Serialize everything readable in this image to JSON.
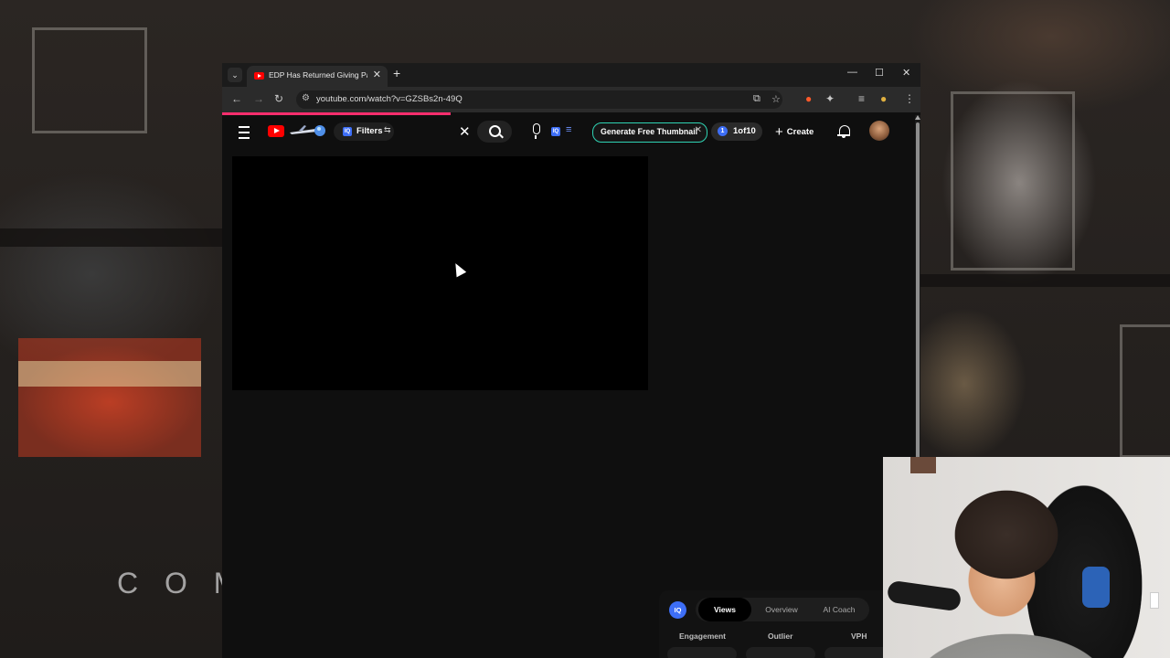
{
  "browser": {
    "tab_title": "EDP Has Returned Giving Parents",
    "url": "youtube.com/watch?v=GZSBs2n-49Q"
  },
  "youtube_header": {
    "filters_label": "Filters",
    "iq_badge": "IQ",
    "generate_label": "Generate Free Thumbnail",
    "counter_label": "1of10",
    "counter_number": "1",
    "create_label": "Create"
  },
  "iq_panel": {
    "logo": "IQ",
    "tabs": [
      "Views",
      "Overview",
      "AI Coach"
    ],
    "active_tab": "Views",
    "metrics": [
      "Engagement",
      "Outlier",
      "VPH"
    ]
  },
  "background": {
    "text": "C O M"
  },
  "colors": {
    "youtube_red": "#ff0000",
    "accent_blue": "#3d6ef6",
    "generate_border": "#2fd3b3",
    "progress_pink": "#ff2e6e"
  },
  "icons": [
    "tab-search-icon",
    "youtube-favicon",
    "close-icon",
    "plus-icon",
    "minimize-icon",
    "maximize-icon",
    "back-icon",
    "forward-icon",
    "reload-icon",
    "site-info-icon",
    "install-icon",
    "bookmark-star-icon",
    "extension-icon",
    "puzzle-icon",
    "media-icon",
    "profile-icon",
    "more-icon",
    "menu-icon",
    "search-icon",
    "mic-icon",
    "bell-icon"
  ]
}
